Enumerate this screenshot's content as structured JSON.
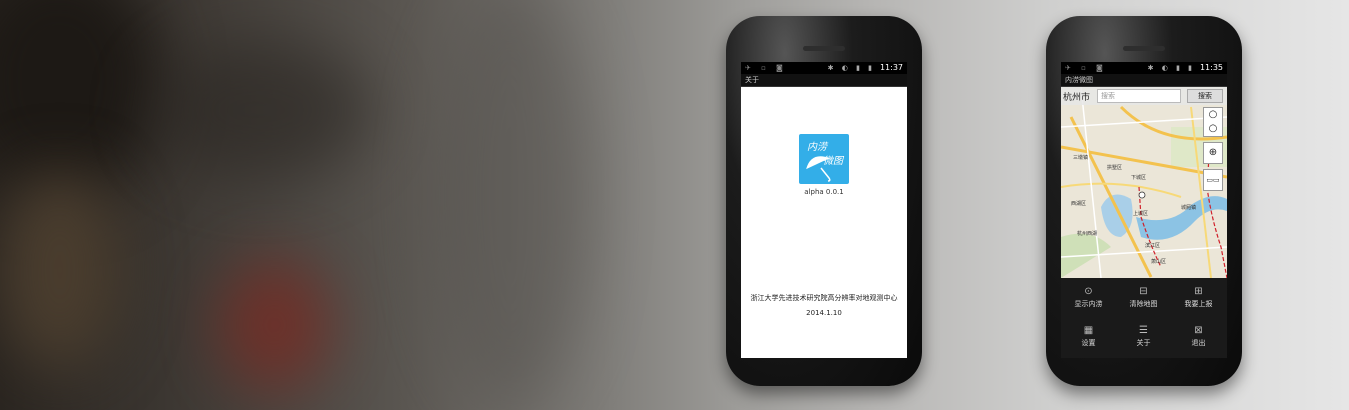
{
  "phone_left": {
    "status_time": "11:37",
    "title": "关于",
    "app_icon_text": [
      "内涝",
      "微图"
    ],
    "version": "alpha 0.0.1",
    "organization": "浙江大学先进技术研究院高分辨率对地观测中心",
    "date": "2014.1.10"
  },
  "phone_right": {
    "status_time": "11:35",
    "title": "内涝微图",
    "city": "杭州市",
    "search_placeholder": "搜索",
    "search_button": "搜索",
    "map_labels": [
      "下城区",
      "拱墅区",
      "上城区",
      "西湖区",
      "滨江区",
      "萧山区",
      "杭州西湖",
      "三墩镇",
      "城厢镇"
    ],
    "menu": [
      {
        "label": "显示内涝",
        "icon": "location-icon"
      },
      {
        "label": "清除地图",
        "icon": "trash-icon"
      },
      {
        "label": "我要上报",
        "icon": "plus-icon"
      },
      {
        "label": "设置",
        "icon": "grid-icon"
      },
      {
        "label": "关于",
        "icon": "list-icon"
      },
      {
        "label": "退出",
        "icon": "close-icon"
      }
    ]
  }
}
